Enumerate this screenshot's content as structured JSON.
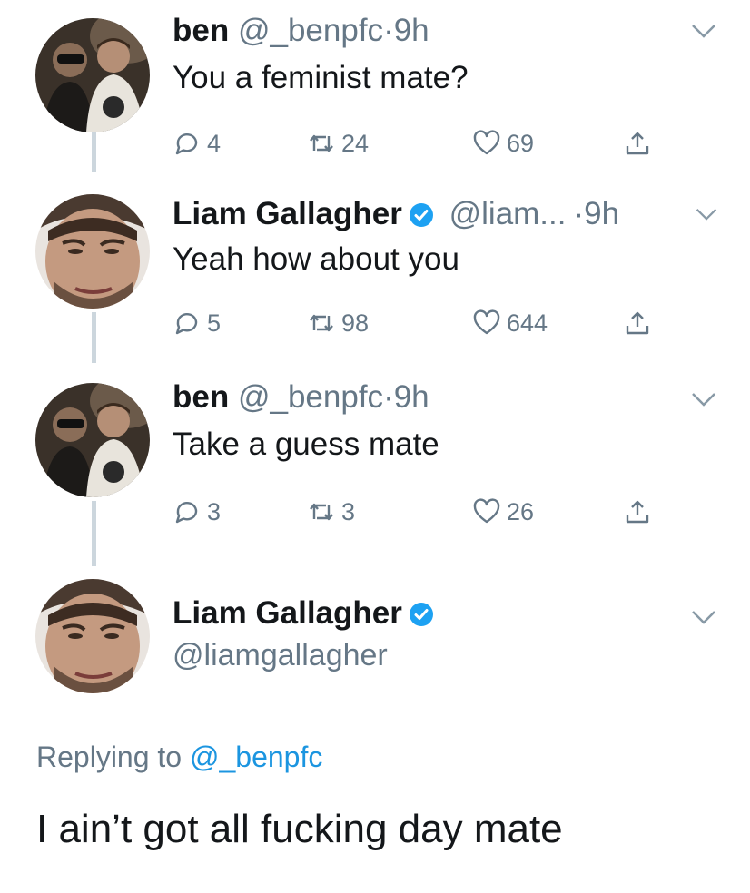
{
  "colors": {
    "accent": "#1da1f2",
    "secondary_text": "#657786",
    "thread_line": "#ccd6dd"
  },
  "thread": [
    {
      "name": "ben",
      "handle": "@_benpfc",
      "separator": "·",
      "time": "9h",
      "verified": false,
      "text": "You a feminist mate?",
      "replies": "4",
      "retweets": "24",
      "likes": "69"
    },
    {
      "name": "Liam Gallagher",
      "handle": "@liam...",
      "separator": "·",
      "time": "9h",
      "verified": true,
      "text": "Yeah how about you",
      "replies": "5",
      "retweets": "98",
      "likes": "644"
    },
    {
      "name": "ben",
      "handle": "@_benpfc",
      "separator": "·",
      "time": "9h",
      "verified": false,
      "text": "Take a guess mate",
      "replies": "3",
      "retweets": "3",
      "likes": "26"
    }
  ],
  "main_tweet": {
    "name": "Liam Gallagher",
    "handle": "@liamgallagher",
    "verified": true,
    "replying_prefix": "Replying to",
    "replying_to": "@_benpfc",
    "text": "I ain’t got all fucking day mate"
  },
  "icons": {
    "reply": "reply-icon",
    "retweet": "retweet-icon",
    "like": "heart-icon",
    "share": "share-icon",
    "more": "chevron-down-icon",
    "verified": "verified-badge-icon"
  }
}
